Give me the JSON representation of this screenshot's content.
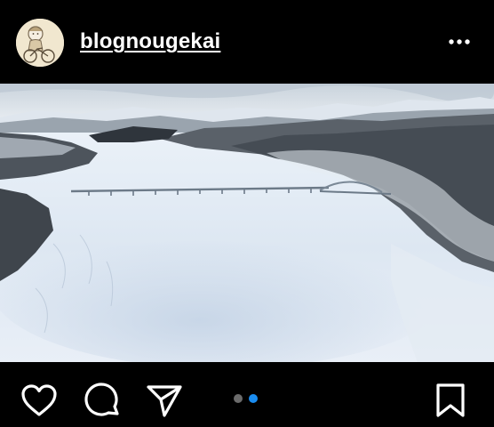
{
  "post": {
    "username": "blognougekai",
    "more_icon": "more-horizontal-icon"
  },
  "image": {
    "description_icon": "snowy-valley-bridge-photo"
  },
  "actions": {
    "like_icon": "heart-icon",
    "comment_icon": "comment-bubble-icon",
    "share_icon": "paper-plane-icon",
    "save_icon": "bookmark-icon"
  },
  "carousel": {
    "total": 2,
    "active_index": 1,
    "active_color": "#1a8cf0",
    "inactive_color": "#6b6b6b"
  },
  "colors": {
    "background": "#000000",
    "text": "#ffffff"
  }
}
